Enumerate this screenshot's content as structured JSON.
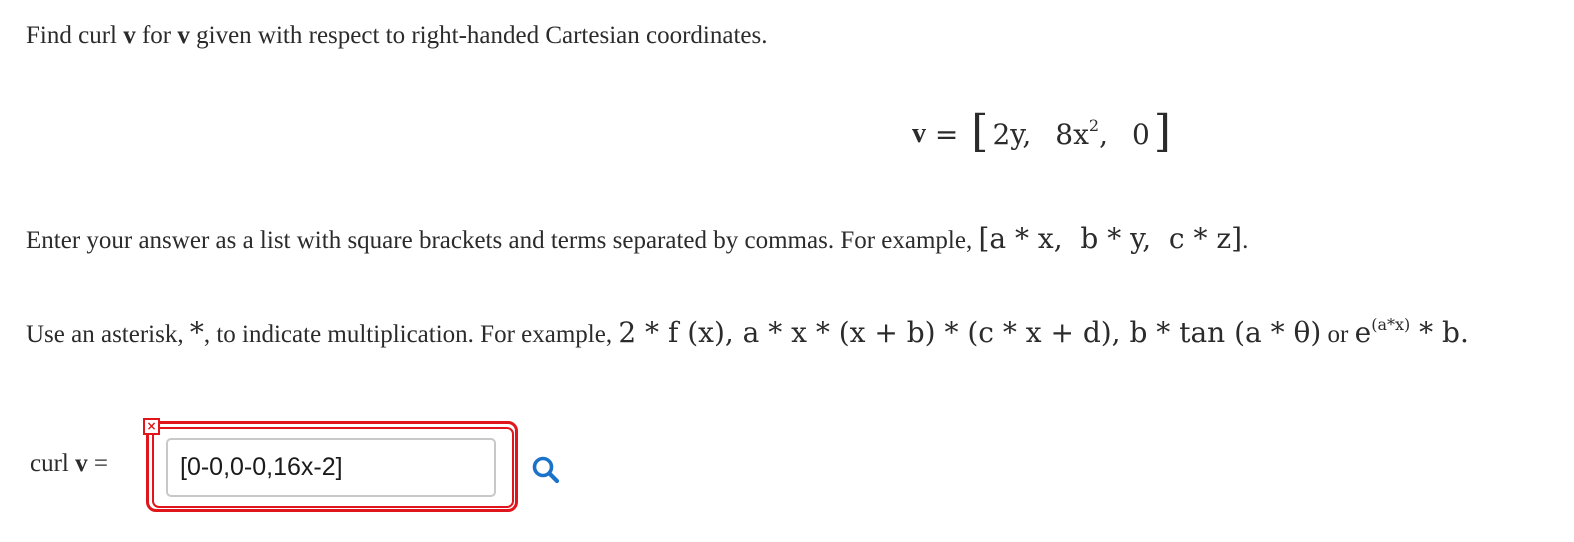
{
  "question": {
    "line1": {
      "a": "Find curl ",
      "v1": "v",
      "b": " for ",
      "v2": "v",
      "c": " given with respect to right-handed Cartesian coordinates."
    },
    "equation": {
      "lhs": "v",
      "eq": " = ",
      "open": "[",
      "c1": "2y,",
      "c2_base": "8x",
      "c2_exp": "2",
      "c2_comma": ",",
      "c3": "0",
      "close": "]"
    },
    "line2": {
      "text": "Enter your answer as a list with square brackets and terms separated by commas. For example, ",
      "example": "[a * x,  b * y,  c * z]",
      "end": "."
    },
    "line3": {
      "text": "Use an asterisk, ",
      "star": "*",
      "mid": ", to indicate multiplication. For example, ",
      "ex1": "2 * f (x), a * x * (x + b) * (c * x + d), b * tan (a * θ)",
      "or": " or ",
      "ex2_base": "e",
      "ex2_exp": "(a*x)",
      "ex2_tail": " * b",
      "end": "."
    }
  },
  "answer": {
    "label_prefix": "curl ",
    "label_v": "v",
    "label_eq": " =",
    "value": "[0-0,0-0,16x-2]",
    "error_mark": "×"
  },
  "icons": {
    "preview": "magnifier-icon",
    "preview_color": "#1a73c9",
    "error_color": "#e0161c"
  }
}
